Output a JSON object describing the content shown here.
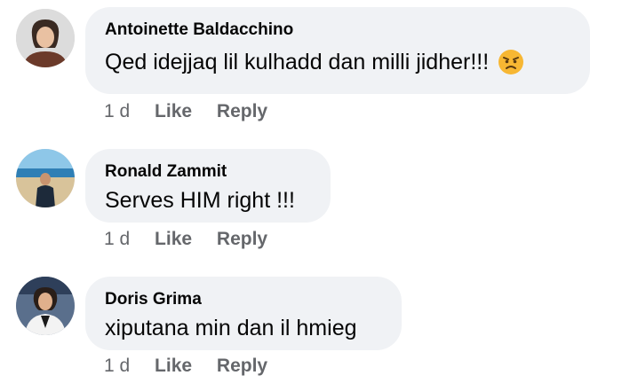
{
  "comments": [
    {
      "author": "Antoinette Baldacchino",
      "text": "Qed idejjaq lil kulhadd dan milli jidher!!!",
      "emoji": "angry-face-emoji",
      "time": "1 d",
      "like_label": "Like",
      "reply_label": "Reply"
    },
    {
      "author": "Ronald Zammit",
      "text": "Serves HIM right !!!",
      "time": "1 d",
      "like_label": "Like",
      "reply_label": "Reply"
    },
    {
      "author": "Doris Grima",
      "text": "xiputana min dan il hmieg",
      "time": "1 d",
      "like_label": "Like",
      "reply_label": "Reply"
    }
  ],
  "colors": {
    "bubble": "#f0f2f5",
    "meta_text": "#65676b",
    "primary_text": "#050505"
  }
}
